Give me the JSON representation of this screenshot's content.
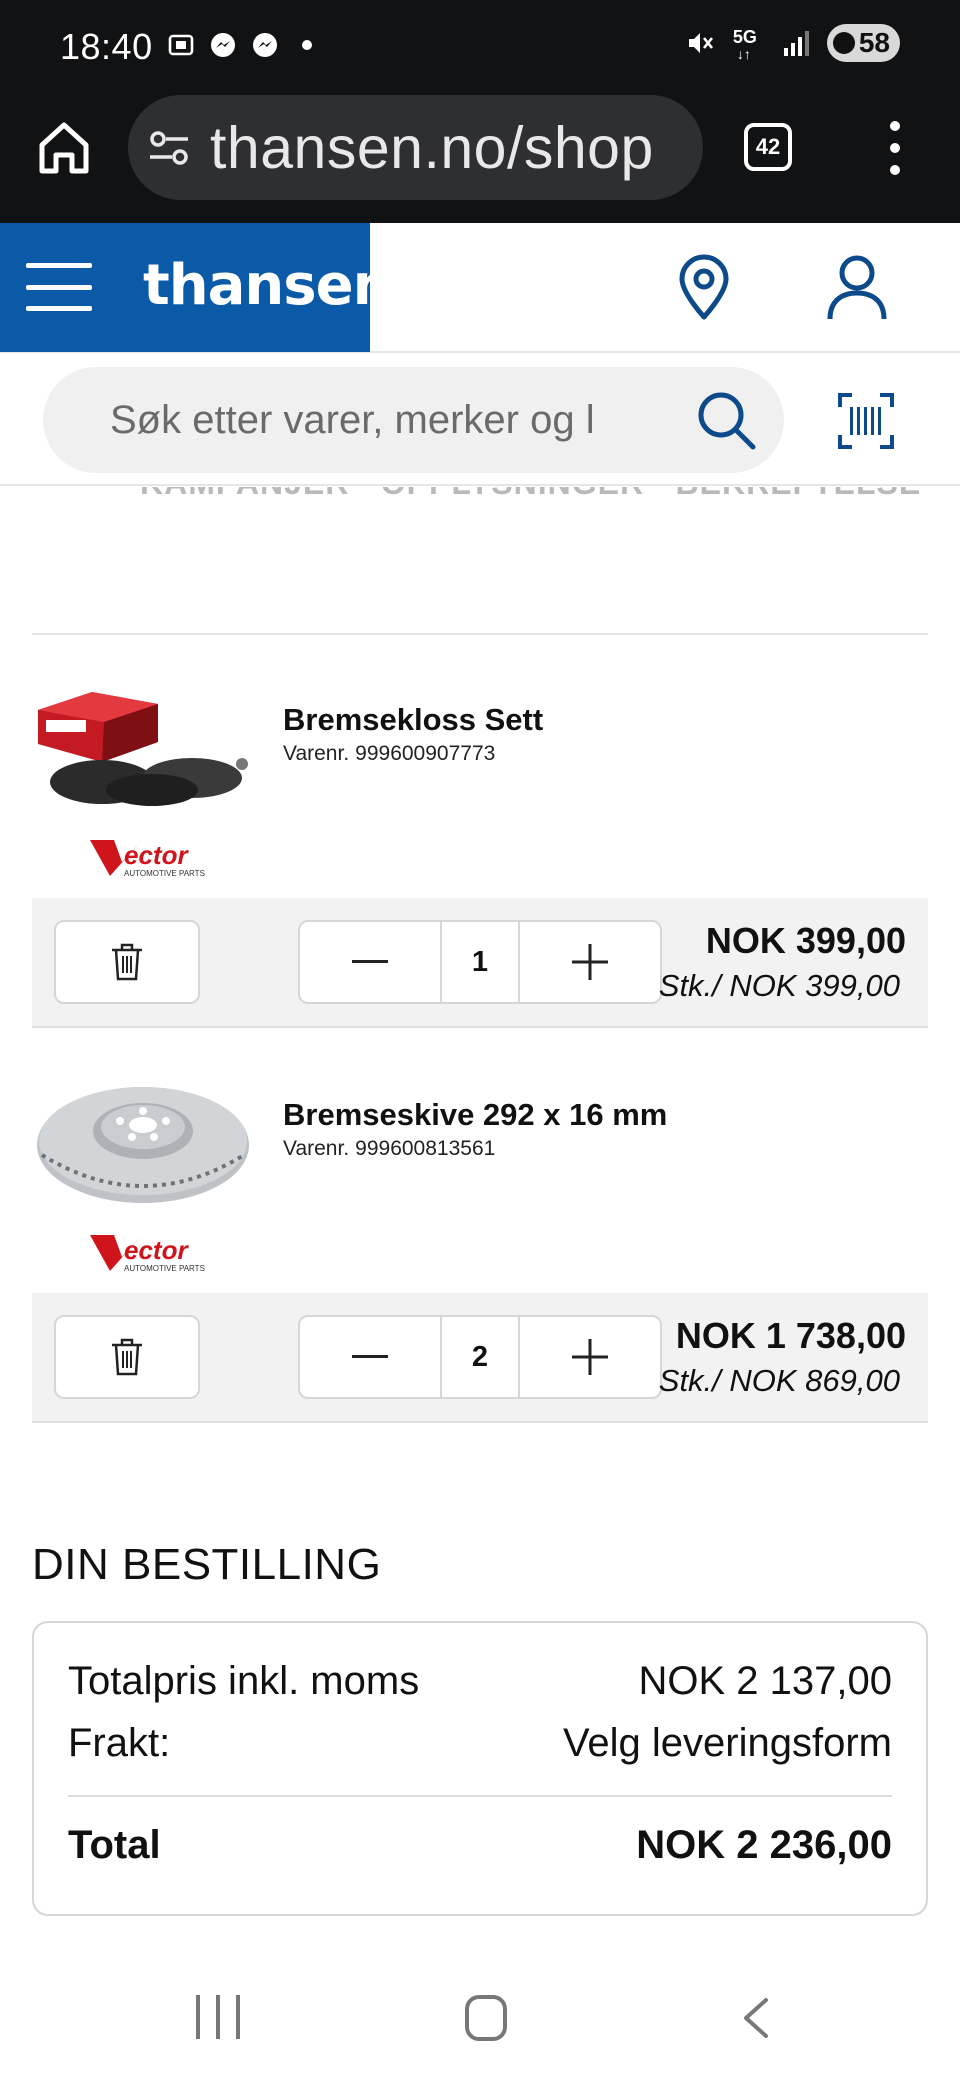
{
  "status_bar": {
    "time": "18:40",
    "network": "5G",
    "battery": "58"
  },
  "browser": {
    "url": "thansen.no/shop",
    "tab_count": "42"
  },
  "site": {
    "brand": "thansen",
    "search_placeholder": "Søk etter varer, merker og l",
    "breadcrumb": "KAMPANJER · OPPLYSNINGER · BEKREFTELSE"
  },
  "cart": {
    "items": [
      {
        "name": "Bremsekloss Sett",
        "sku_label": "Varenr.",
        "sku": "999600907773",
        "brand": "vector",
        "brand_sub": "AUTOMOTIVE PARTS",
        "quantity": "1",
        "total_price": "NOK 399,00",
        "unit_price": "Stk./ NOK 399,00"
      },
      {
        "name": "Bremseskive 292 x 16 mm",
        "sku_label": "Varenr.",
        "sku": "999600813561",
        "brand": "vector",
        "brand_sub": "AUTOMOTIVE PARTS",
        "quantity": "2",
        "total_price": "NOK 1 738,00",
        "unit_price": "Stk./ NOK 869,00"
      }
    ]
  },
  "summary": {
    "title": "DIN BESTILLING",
    "subtotal_label": "Totalpris inkl. moms",
    "subtotal_value": "NOK 2 137,00",
    "shipping_label": "Frakt:",
    "shipping_value": "Velg leveringsform",
    "total_label": "Total",
    "total_value": "NOK 2 236,00"
  },
  "colors": {
    "brand_blue": "#0a5aa8",
    "icon_blue": "#0d4a8a",
    "vector_red": "#d0141b"
  }
}
